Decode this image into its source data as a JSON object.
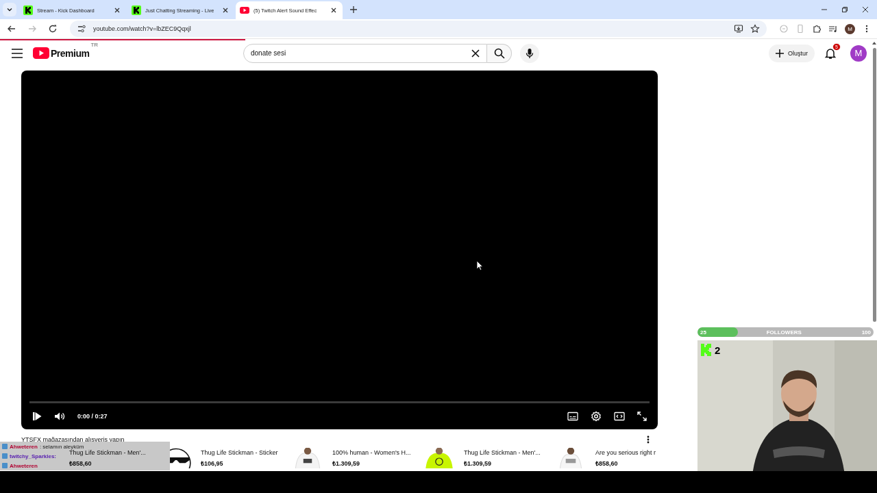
{
  "browser": {
    "tabs": [
      {
        "title": "Stream - Kick Dashboard",
        "kind": "kick",
        "selected": false
      },
      {
        "title": "Just Chatting Streaming - Live",
        "kind": "kick",
        "selected": false
      },
      {
        "title": "(5) Twitch Alert Sound Effec",
        "kind": "youtube",
        "selected": true
      }
    ],
    "url": "youtube.com/watch?v=lbZEC9Qqxjl",
    "profile": "M",
    "load_progress": {
      "level": 0.28
    }
  },
  "header": {
    "logo": "Premium",
    "region": "TR",
    "search": {
      "value": "donate sesi"
    },
    "create_label": "Oluştur",
    "notification_count": "5",
    "avatar": "M"
  },
  "player": {
    "playing": false,
    "time": "0:00 / 0:27"
  },
  "shelf": {
    "title": "YTSFX mağazasından alışveriş yapın",
    "products": [
      {
        "name": "Thug Life Stickman - Men'...",
        "price": "₺858,60"
      },
      {
        "name": "Thug Life Stickman - Sticker",
        "price": "₺106,95"
      },
      {
        "name": "100% human - Women's H...",
        "price": "₺1.309,59"
      },
      {
        "name": "Thug Life Stickman - Men'...",
        "price": "₺1.309,59"
      },
      {
        "name": "Are you serious right r",
        "price": "₺858,60"
      }
    ]
  },
  "chat_overlay": {
    "messages": [
      {
        "user": "Ahweteren",
        "color": "#b00030",
        "text": ": selamın aleyküm"
      },
      {
        "user": "twitchy_Sparkles:",
        "color": "#5a22b0"
      },
      {
        "user": "Ahweteren",
        "color": "#b00030"
      }
    ]
  },
  "followers": {
    "low": "25",
    "label": "FOLLOWERS",
    "high": "100",
    "level": 0.23
  },
  "webcam": {
    "count": "2"
  }
}
